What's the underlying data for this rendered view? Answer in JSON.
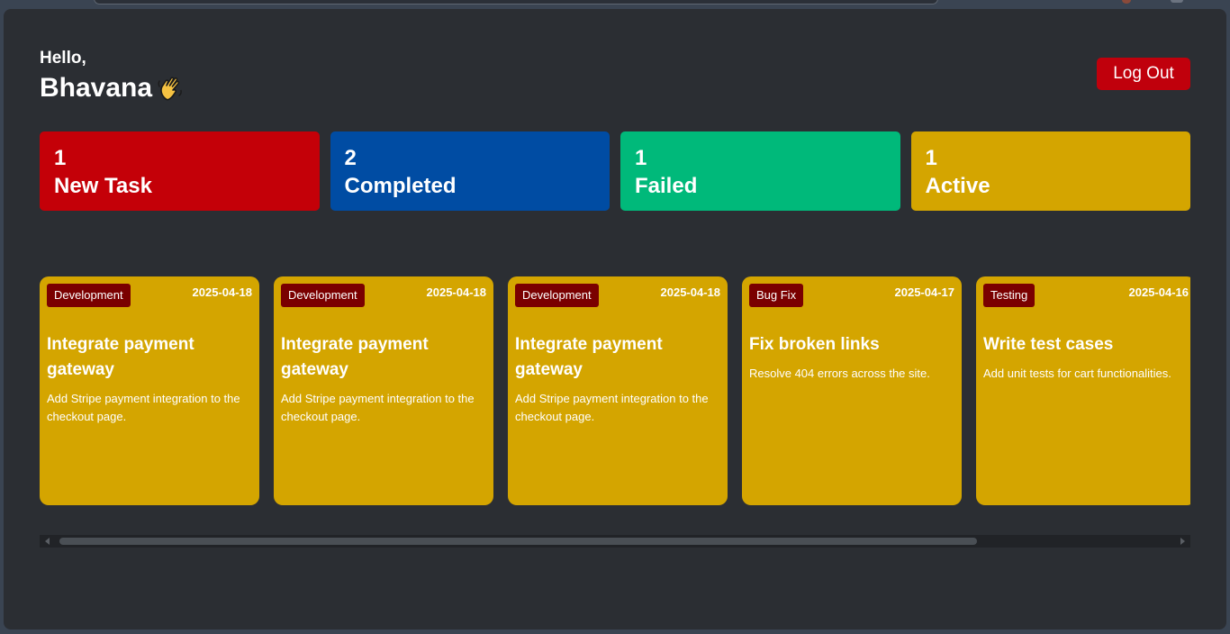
{
  "header": {
    "greeting": "Hello,",
    "username": "Bhavana",
    "logout_label": "Log Out"
  },
  "stats": [
    {
      "count": "1",
      "label": "New Task",
      "color": "#c40008"
    },
    {
      "count": "2",
      "label": "Completed",
      "color": "#004ca3"
    },
    {
      "count": "1",
      "label": "Failed",
      "color": "#00b97a"
    },
    {
      "count": "1",
      "label": "Active",
      "color": "#d4a500"
    }
  ],
  "tasks": [
    {
      "category": "Development",
      "date": "2025-04-18",
      "title": "Integrate payment gateway",
      "description": "Add Stripe payment integration to the checkout page."
    },
    {
      "category": "Development",
      "date": "2025-04-18",
      "title": "Integrate payment gateway",
      "description": "Add Stripe payment integration to the checkout page."
    },
    {
      "category": "Development",
      "date": "2025-04-18",
      "title": "Integrate payment gateway",
      "description": "Add Stripe payment integration to the checkout page."
    },
    {
      "category": "Bug Fix",
      "date": "2025-04-17",
      "title": "Fix broken links",
      "description": "Resolve 404 errors across the site."
    },
    {
      "category": "Testing",
      "date": "2025-04-16",
      "title": "Write test cases",
      "description": "Add unit tests for cart functionalities."
    }
  ],
  "colors": {
    "task_card": "#d4a500",
    "badge": "#7a0000",
    "logout": "#c0000c",
    "background": "#2b2e33"
  },
  "icons": {
    "wave": "waving-hand-icon"
  }
}
